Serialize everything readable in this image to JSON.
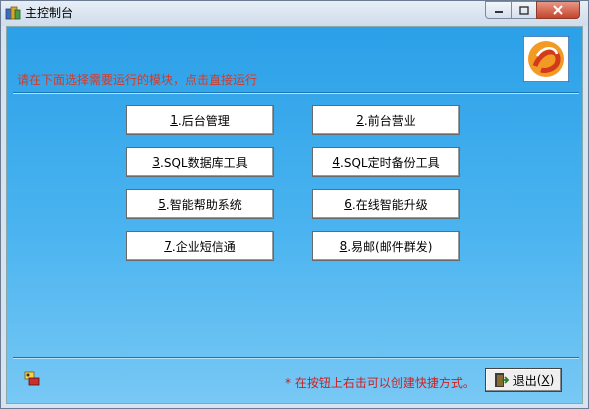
{
  "window": {
    "title": "主控制台"
  },
  "header": {
    "instruction": "请在下面选择需要运行的模块，点击直接运行"
  },
  "buttons": [
    {
      "key": "1",
      "label": ".后台管理"
    },
    {
      "key": "2",
      "label": ".前台营业"
    },
    {
      "key": "3",
      "label": ".SQL数据库工具"
    },
    {
      "key": "4",
      "label": ".SQL定时备份工具"
    },
    {
      "key": "5",
      "label": ".智能帮助系统"
    },
    {
      "key": "6",
      "label": ".在线智能升级"
    },
    {
      "key": "7",
      "label": ".企业短信通"
    },
    {
      "key": "8",
      "label": ".易邮(邮件群发)"
    }
  ],
  "footer": {
    "hint": "* 在按钮上右击可以创建快捷方式。",
    "exit_label": "退出",
    "exit_key": "X"
  },
  "icons": {
    "app": "app-books-icon",
    "logo": "brand-logo-icon",
    "utility": "key-tool-icon",
    "exit": "exit-door-icon"
  },
  "colors": {
    "accent": "#2ba0e8",
    "hint_text": "#cc1f1f"
  }
}
